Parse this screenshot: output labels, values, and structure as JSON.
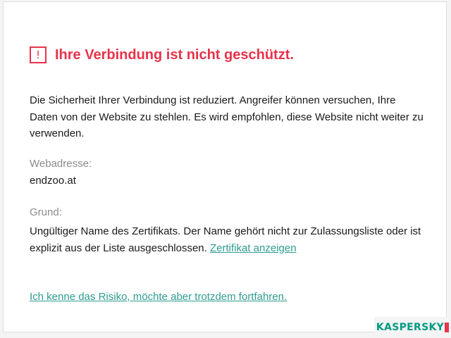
{
  "warning": {
    "icon": "warning-exclamation-icon",
    "icon_glyph": "!",
    "title": "Ihre Verbindung ist nicht geschützt.",
    "accent_color": "#e8334a"
  },
  "description": "Die Sicherheit Ihrer Verbindung ist reduziert. Angreifer können versuchen, Ihre Daten von der Website zu stehlen. Es wird empfohlen, diese Website nicht weiter zu verwenden.",
  "address": {
    "label": "Webadresse:",
    "value": "endzoo.at"
  },
  "reason": {
    "label": "Grund:",
    "text": "Ungültiger Name des Zertifikats. Der Name gehört nicht zur Zulassungsliste oder ist explizit aus der Liste ausgeschlossen. ",
    "link": "Zertifikat anzeigen"
  },
  "proceed_link": "Ich kenne das Risiko, möchte aber trotzdem fortfahren.",
  "link_color": "#2d9c8f",
  "brand": {
    "name": "KASPERSKY",
    "color": "#009982"
  }
}
